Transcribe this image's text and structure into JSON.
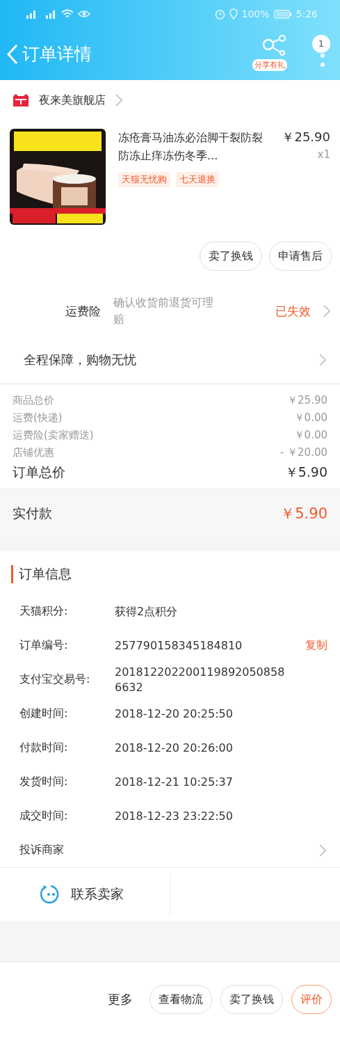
{
  "status_bar": {
    "battery": "100%",
    "time": "5:26"
  },
  "header": {
    "title": "订单详情",
    "share_badge": "分享有礼",
    "notification_count": "1"
  },
  "shop": {
    "name": "夜来美旗舰店"
  },
  "product": {
    "kind": "picture",
    "title": "冻疮膏马油冻必治脚干裂防裂防冻止痒冻伤冬季...",
    "price": "￥25.90",
    "quantity": "x1",
    "tags": [
      "天猫无忧购",
      "七天退换"
    ]
  },
  "item_actions": [
    "卖了换钱",
    "申请售后"
  ],
  "insurance": {
    "label": "运费险",
    "description": "确认收货前退货可理赔",
    "status": "已失效"
  },
  "guarantee": "全程保障，购物无忧",
  "price_lines": [
    {
      "label": "商品总价",
      "value": "￥25.90"
    },
    {
      "label": "运费(快递)",
      "value": "￥0.00"
    },
    {
      "label": "运费险(卖家赠送)",
      "value": "￥0.00"
    },
    {
      "label": "店铺优惠",
      "value": "- ￥20.00"
    }
  ],
  "order_total": {
    "label": "订单总价",
    "value": "￥5.90"
  },
  "paid": {
    "label": "实付款",
    "value": "￥5.90"
  },
  "order_info": {
    "title": "订单信息",
    "rows": [
      {
        "label": "天猫积分:",
        "value": "获得2点积分"
      },
      {
        "label": "订单编号:",
        "value": "257790158345184810",
        "action": "复制"
      },
      {
        "label": "支付宝交易号:",
        "value": "2018122022001198920508586632"
      },
      {
        "label": "创建时间:",
        "value": "2018-12-20 20:25:50"
      },
      {
        "label": "付款时间:",
        "value": "2018-12-20 20:26:00"
      },
      {
        "label": "发货时间:",
        "value": "2018-12-21 10:25:37"
      },
      {
        "label": "成交时间:",
        "value": "2018-12-23 23:22:50"
      }
    ]
  },
  "complaint": "投诉商家",
  "contact": "联系卖家",
  "bottom_bar": {
    "more": "更多",
    "buttons": [
      {
        "label": "查看物流",
        "primary": false
      },
      {
        "label": "卖了换钱",
        "primary": false
      },
      {
        "label": "评价",
        "primary": true
      }
    ]
  }
}
